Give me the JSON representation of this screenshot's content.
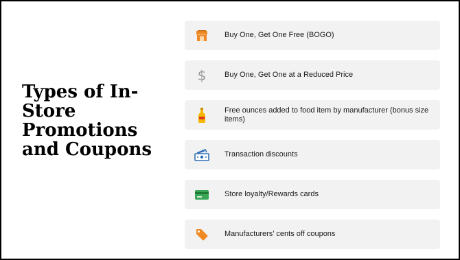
{
  "slide": {
    "title_lines": [
      "Types of In-",
      "Store",
      "Promotions",
      "and Coupons"
    ]
  },
  "promotions": [
    {
      "label": "Buy One, Get One Free (BOGO)",
      "icon": "store-awning-icon",
      "color": "#f08a24"
    },
    {
      "label": "Buy One, Get One at a Reduced Price",
      "icon": "dollar-icon",
      "color": "#9a9a9a"
    },
    {
      "label": "Free ounces added to food item by manufacturer (bonus size items)",
      "icon": "bottle-icon",
      "color": "#f5b800"
    },
    {
      "label": "Transaction discounts",
      "icon": "cash-icon",
      "color": "#2f6fb5"
    },
    {
      "label": "Store loyalty/Rewards cards",
      "icon": "credit-card-icon",
      "color": "#3aa655"
    },
    {
      "label": "Manufacturers’ cents off coupons",
      "icon": "price-tag-icon",
      "color": "#f08a24"
    }
  ]
}
